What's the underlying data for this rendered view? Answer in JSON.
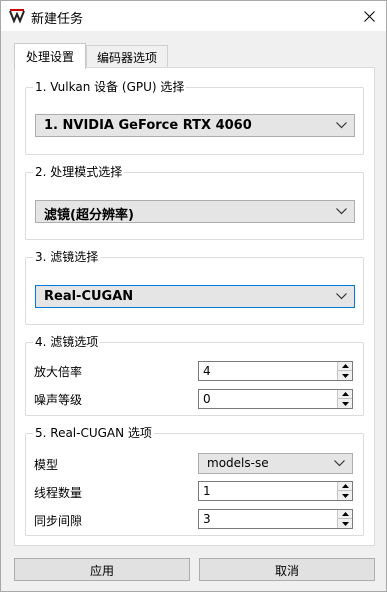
{
  "window": {
    "title": "新建任务"
  },
  "tabs": [
    {
      "label": "处理设置"
    },
    {
      "label": "编码器选项"
    }
  ],
  "group1": {
    "title": "1. Vulkan 设备 (GPU) 选择",
    "device_value": "1. NVIDIA GeForce RTX 4060"
  },
  "group2": {
    "title": "2. 处理模式选择",
    "mode_value": "滤镜(超分辨率)"
  },
  "group3": {
    "title": "3. 滤镜选择",
    "filter_value": "Real-CUGAN"
  },
  "group4": {
    "title": "4. 滤镜选项",
    "scale_label": "放大倍率",
    "scale_value": "4",
    "noise_label": "噪声等级",
    "noise_value": "0"
  },
  "group5": {
    "title": "5. Real-CUGAN 选项",
    "model_label": "模型",
    "model_value": "models-se",
    "threads_label": "线程数量",
    "threads_value": "1",
    "syncgap_label": "同步间隙",
    "syncgap_value": "3"
  },
  "buttons": {
    "apply": "应用",
    "cancel": "取消"
  }
}
